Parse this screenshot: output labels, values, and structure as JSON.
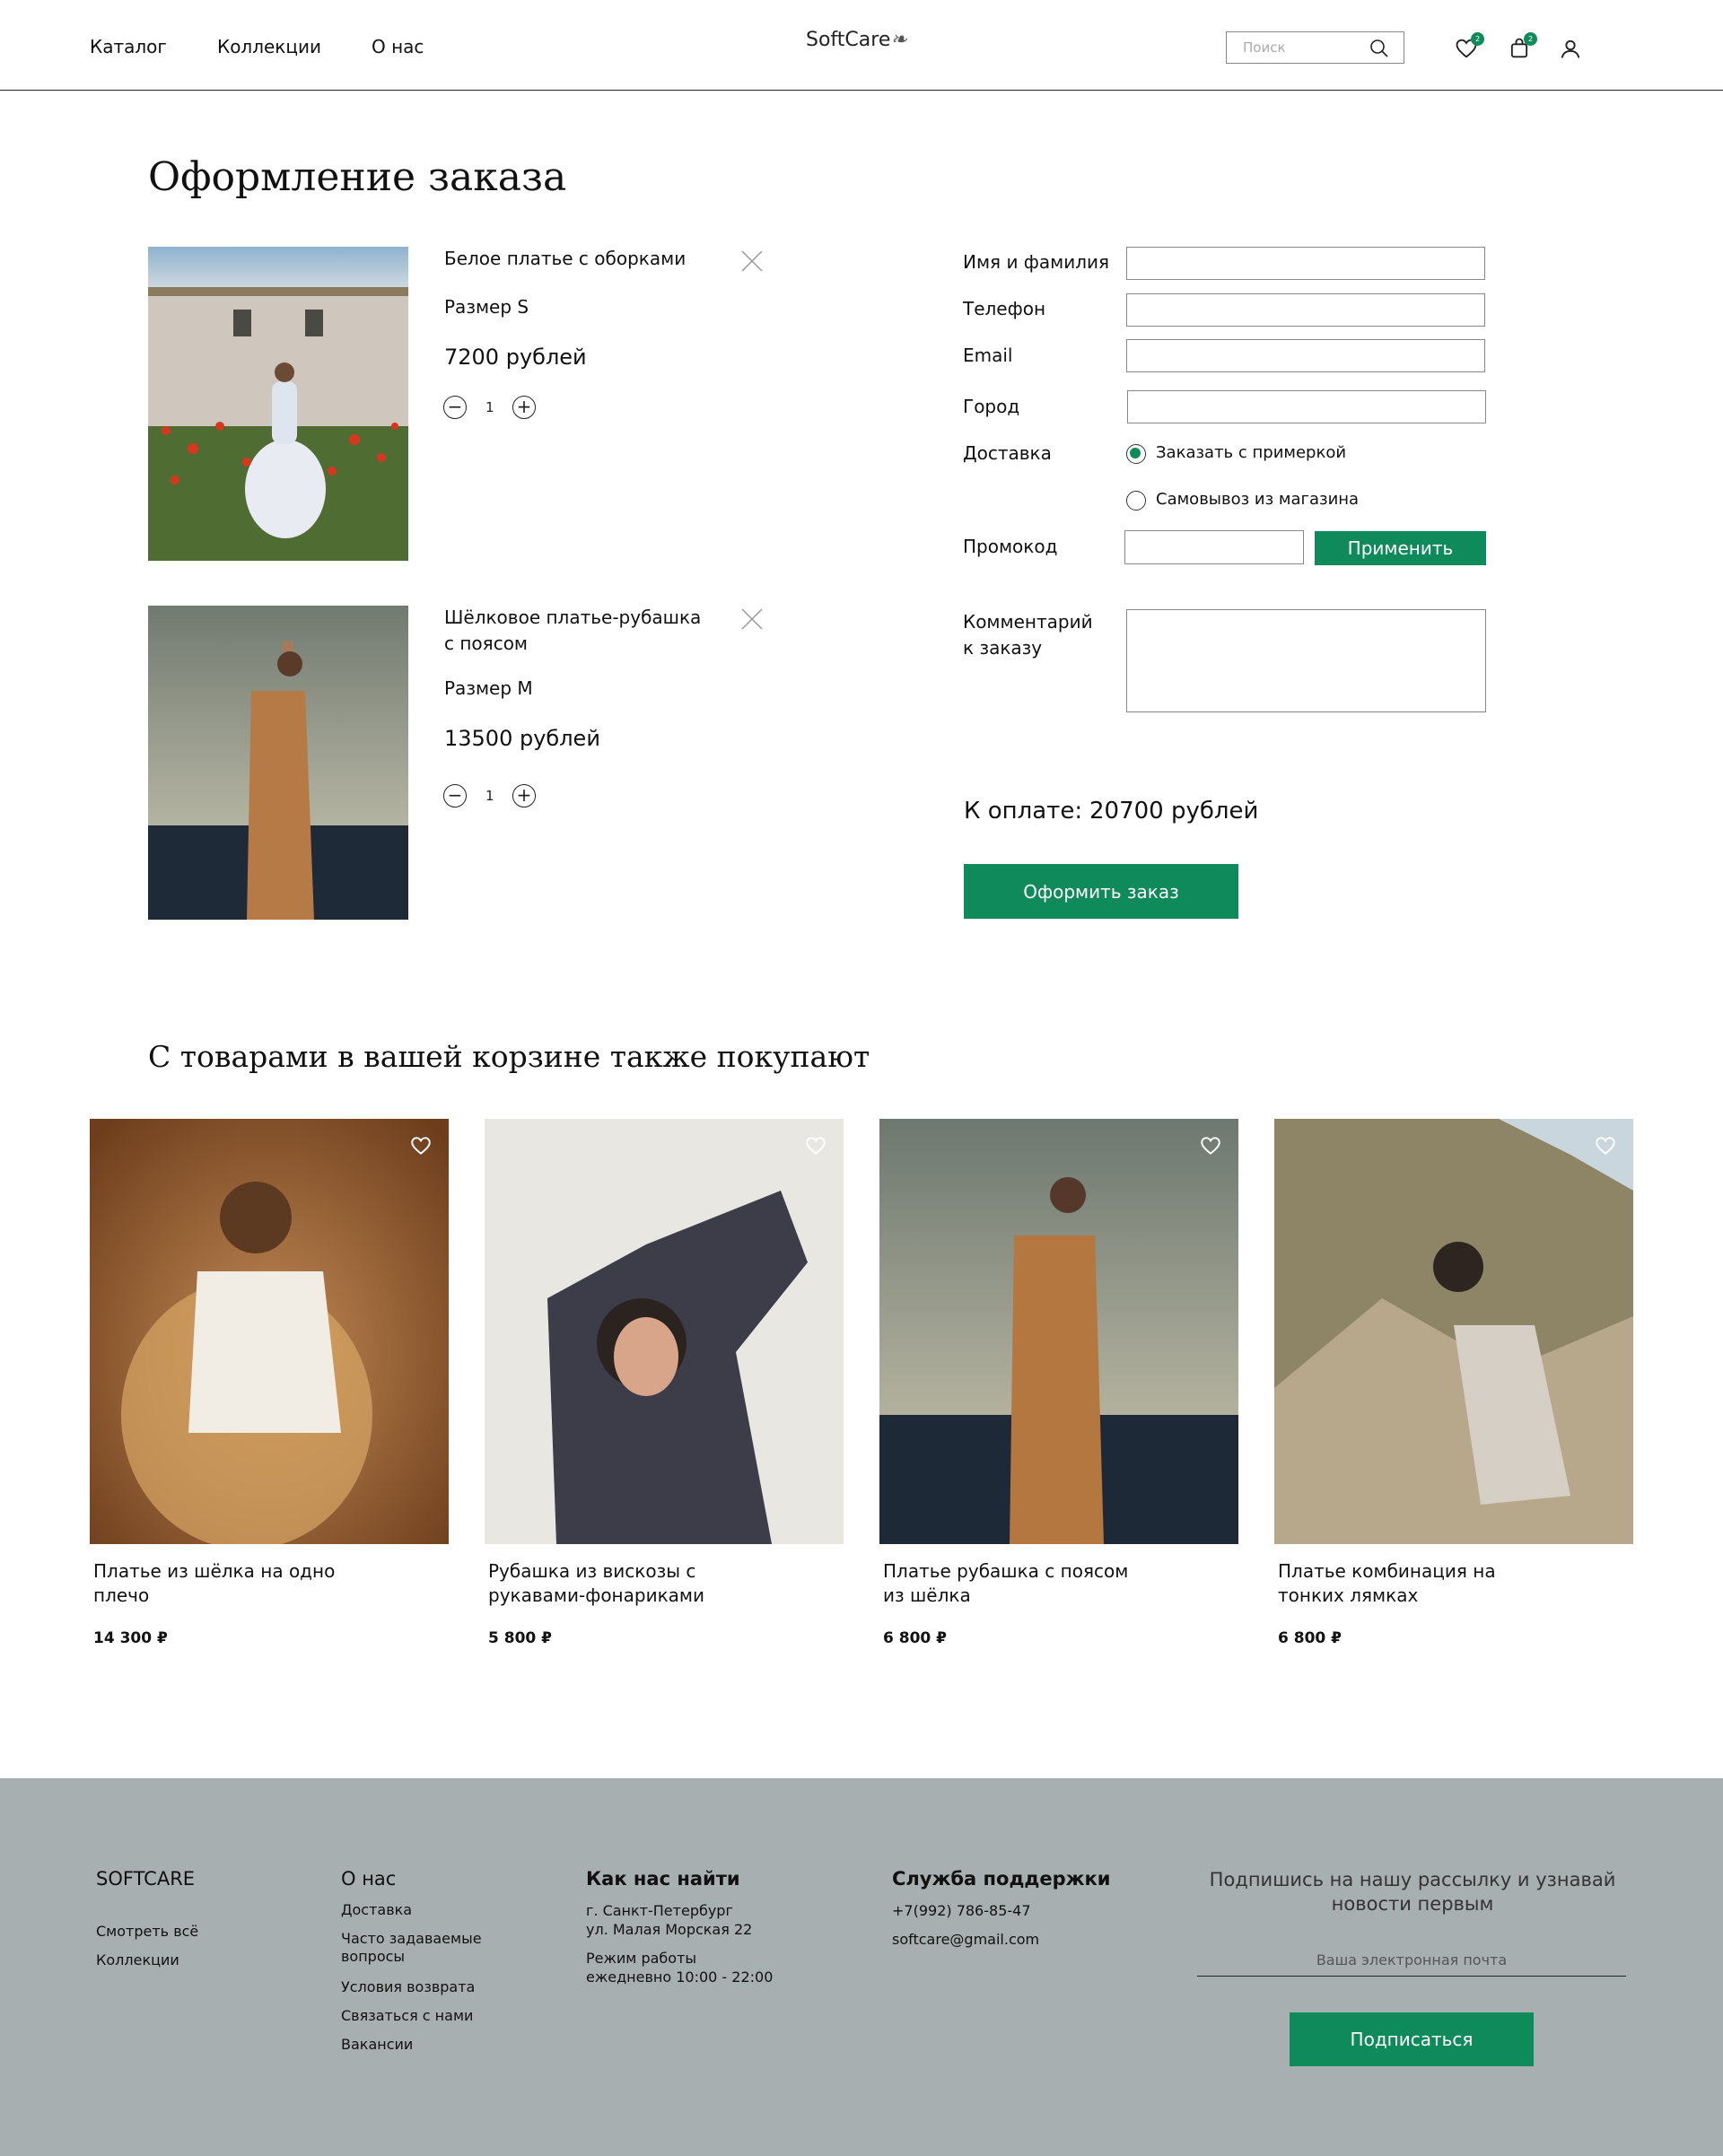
{
  "header": {
    "nav": [
      "Каталог",
      "Коллекции",
      "О нас"
    ],
    "logo": "SoftCare",
    "search_placeholder": "Поиск",
    "wishlist_count": "2",
    "cart_count": "2"
  },
  "checkout": {
    "title": "Оформление заказа",
    "items": [
      {
        "name": "Белое платье с оборками",
        "size": "Размер S",
        "price": "7200 рублей",
        "qty": "1"
      },
      {
        "name": "Шёлковое платье-рубашка с поясом",
        "size": "Размер M",
        "price": "13500 рублей",
        "qty": "1"
      }
    ],
    "form": {
      "name_label": "Имя и фамилия",
      "phone_label": "Телефон",
      "email_label": "Email",
      "city_label": "Город",
      "delivery_label": "Доставка",
      "delivery_options": [
        "Заказать с примеркой",
        "Самовывоз из магазина"
      ],
      "delivery_selected": 0,
      "promo_label": "Промокод",
      "apply_label": "Применить",
      "comment_label": "Комментарий к заказу"
    },
    "total_label": "К оплате:",
    "total_value": "20700 рублей",
    "order_button": "Оформить заказ"
  },
  "recommendations": {
    "title": "С товарами в вашей корзине также покупают",
    "products": [
      {
        "name": "Платье из шёлка на одно плечо",
        "price": "14 300 ₽"
      },
      {
        "name": "Рубашка из вискозы с рукавами-фонариками",
        "price": "5 800 ₽"
      },
      {
        "name": "Платье рубашка с поясом из шёлка",
        "price": "6 800 ₽"
      },
      {
        "name": "Платье комбинация на тонких лямках",
        "price": "6 800 ₽"
      }
    ]
  },
  "footer": {
    "brand": "SOFTCARE",
    "brand_links": [
      "Смотреть всё",
      "Коллекции"
    ],
    "about_title": "О нас",
    "about_links": [
      "Доставка",
      "Часто задаваемые вопросы",
      "Условия возврата",
      "Связаться с нами",
      "Вакансии"
    ],
    "find_title": "Как нас найти",
    "address": "г. Санкт-Петербург ул. Малая Морская 22",
    "hours": "Режим работы ежедневно 10:00 - 22:00",
    "support_title": "Служба поддержки",
    "phone": "+7(992) 786-85-47",
    "email": "softcare@gmail.com",
    "subscribe_text": "Подпишись на нашу рассылку и узнавай новости первым",
    "email_placeholder": "Ваша электронная почта",
    "subscribe_button": "Подписаться"
  },
  "colors": {
    "accent": "#0f8a5a",
    "footer_bg": "#a8afb1"
  },
  "icons": [
    "search-icon",
    "heart-icon",
    "bag-icon",
    "user-icon",
    "close-icon",
    "minus-icon",
    "plus-icon"
  ]
}
